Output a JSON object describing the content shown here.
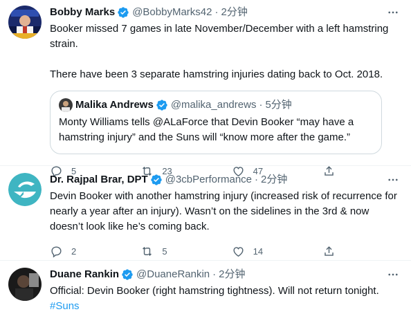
{
  "tweets": [
    {
      "name": "Bobby Marks",
      "handle": "@BobbyMarks42",
      "dot": "·",
      "time": "2分钟",
      "text": "Booker missed 7 games in late November/December with a left hamstring strain.\n\nThere have been 3 separate hamstring injuries dating back to Oct. 2018.",
      "quote": {
        "name": "Malika Andrews",
        "handle": "@malika_andrews",
        "dot": "·",
        "time": "5分钟",
        "text": "Monty Williams tells @ALaForce that Devin Booker “may have a hamstring injury” and the Suns will “know more after the game.”"
      },
      "replies": "5",
      "retweets": "23",
      "likes": "47"
    },
    {
      "name": "Dr. Rajpal Brar, DPT",
      "handle": "@3cbPerformance",
      "dot": "·",
      "time": "2分钟",
      "text": "Devin Booker with another hamstring injury (increased risk of recurrence for nearly a year after an injury). Wasn’t on the sidelines in the 3rd & now doesn’t look like he’s coming back.",
      "replies": "2",
      "retweets": "5",
      "likes": "14"
    },
    {
      "name": "Duane Rankin",
      "handle": "@DuaneRankin",
      "dot": "·",
      "time": "2分钟",
      "text": "Official: Devin Booker (right hamstring tightness). Will not return tonight.",
      "hashtag": "#Suns"
    }
  ],
  "colors": {
    "accent": "#1d9bf0",
    "text": "#0f1419",
    "muted": "#536471",
    "border": "#eff3f4",
    "logo_teal": "#3fb5c2"
  },
  "icons": [
    "verified-icon",
    "more-icon",
    "reply-icon",
    "retweet-icon",
    "like-icon",
    "share-icon"
  ]
}
